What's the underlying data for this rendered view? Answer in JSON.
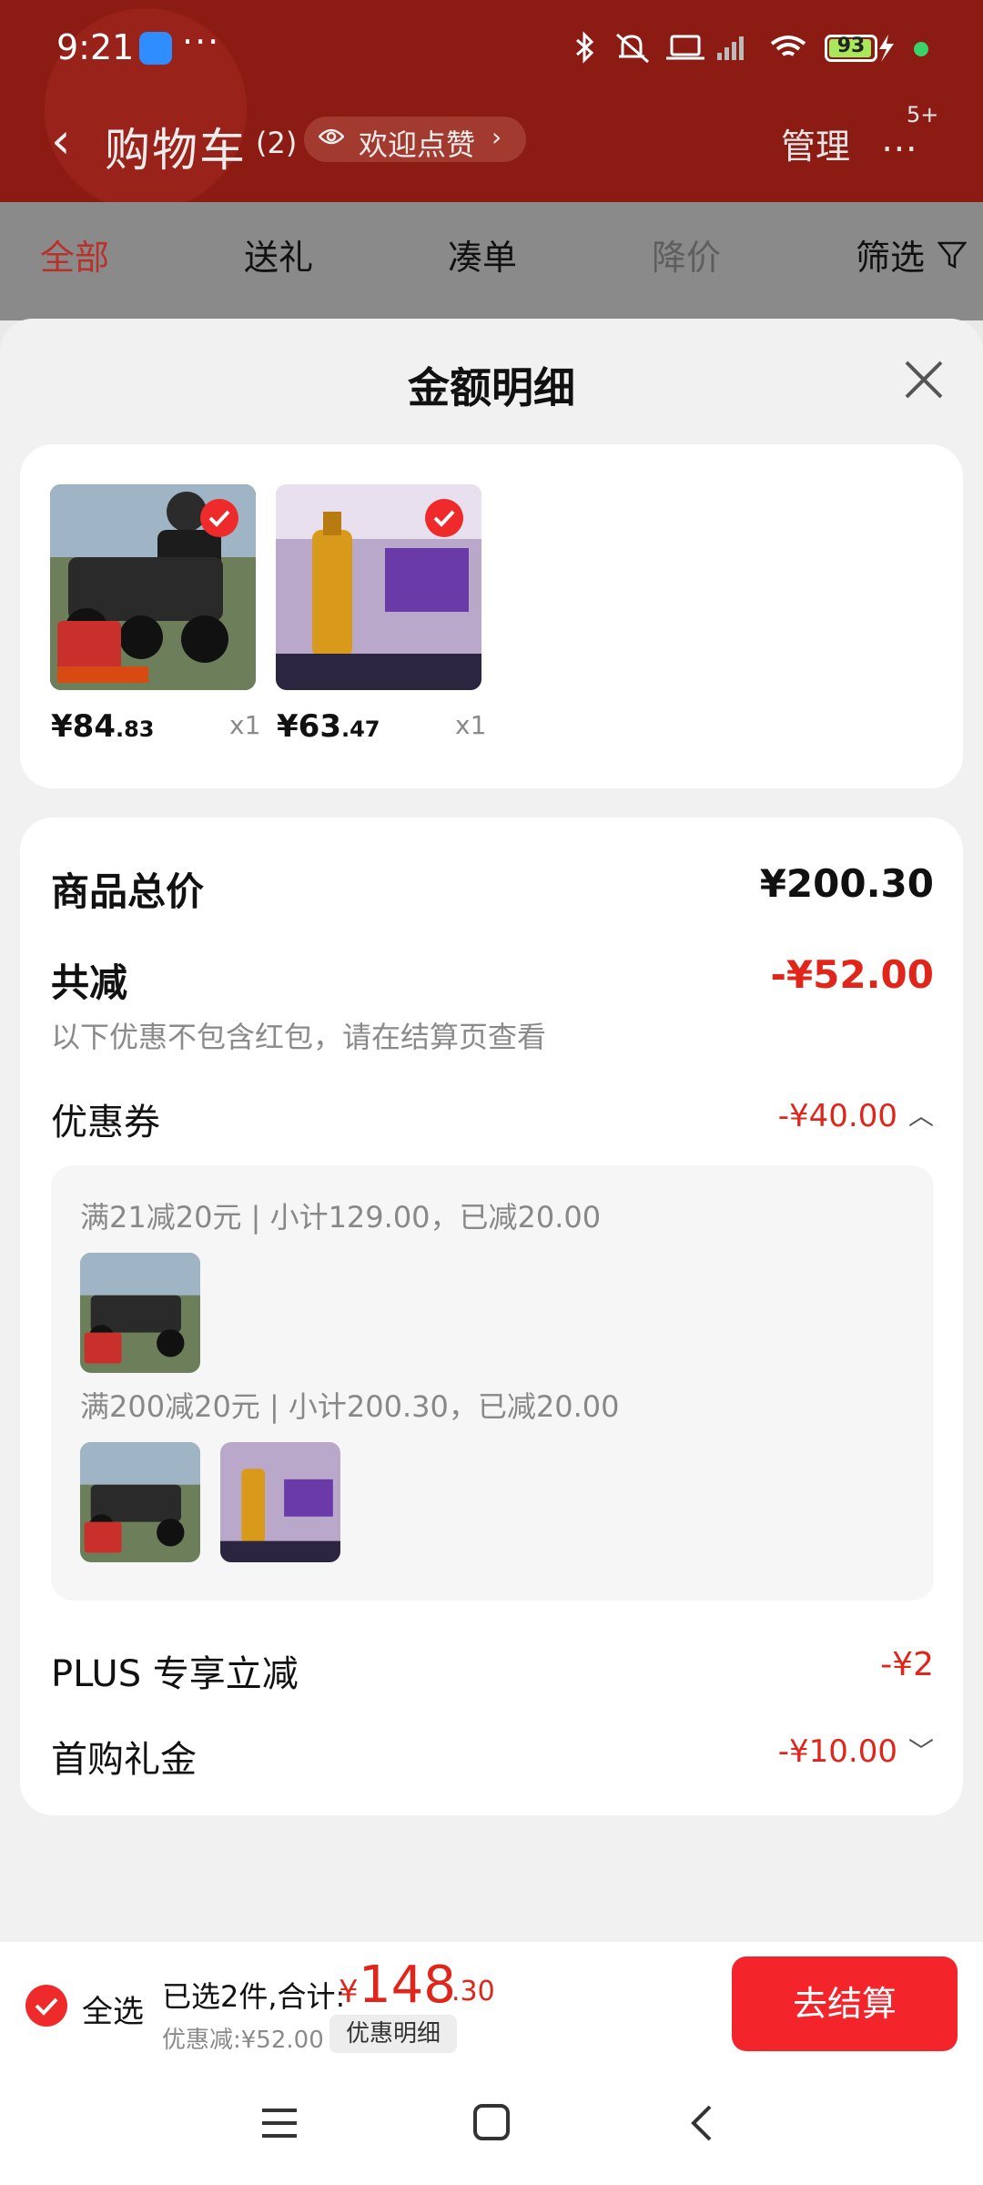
{
  "status_bar": {
    "time": "9:21",
    "battery": "93",
    "app_icon": "blue-app-icon",
    "dots": "···"
  },
  "header": {
    "back_icon": "back-chevron-icon",
    "title": "购物车",
    "count": "(2)",
    "pill_icon": "eye-icon",
    "pill_text": "欢迎点赞",
    "pill_chevron": "›",
    "manage": "管理",
    "more_icon": "more-dots-icon",
    "more_badge": "5+"
  },
  "tabs": [
    {
      "label": "全部",
      "active": true
    },
    {
      "label": "送礼"
    },
    {
      "label": "凑单"
    },
    {
      "label": "降价"
    },
    {
      "label": "筛选"
    }
  ],
  "sheet": {
    "title": "金额明细",
    "close_icon": "close-icon",
    "products": [
      {
        "name": "rc-truck-toy",
        "price_int": "¥84",
        "price_dec": ".83",
        "qty": "x1"
      },
      {
        "name": "loreal-hair-oil",
        "price_int": "¥63",
        "price_dec": ".47",
        "qty": "x1"
      }
    ],
    "summary": {
      "total_label": "商品总价",
      "total_value": "¥200.30",
      "reduce_label": "共减",
      "reduce_value": "-¥52.00",
      "note": "以下优惠不包含红包，请在结算页查看",
      "coupon_label": "优惠券",
      "coupon_value": "-¥40.00",
      "coupon_chevron": "︿",
      "coupons": [
        {
          "text": "满21减20元 | 小计129.00，已减20.00"
        },
        {
          "text": "满200减20元 | 小计200.30，已减20.00"
        }
      ],
      "plus_label": "PLUS 专享立减",
      "plus_value": "-¥2",
      "first_label": "首购礼金",
      "first_value": "-¥10.00",
      "first_chevron": "﹀"
    }
  },
  "bottom": {
    "select_all": "全选",
    "selected_text": "已选2件,合计:",
    "total_symbol": "¥",
    "total_int": "148",
    "total_dec": ".30",
    "discount_text": "优惠减:¥52.00",
    "detail_button": "优惠明细",
    "checkout": "去结算"
  },
  "colors": {
    "header": "#8c1b14",
    "accent_red": "#e0251b",
    "checkout": "#f3252b"
  }
}
